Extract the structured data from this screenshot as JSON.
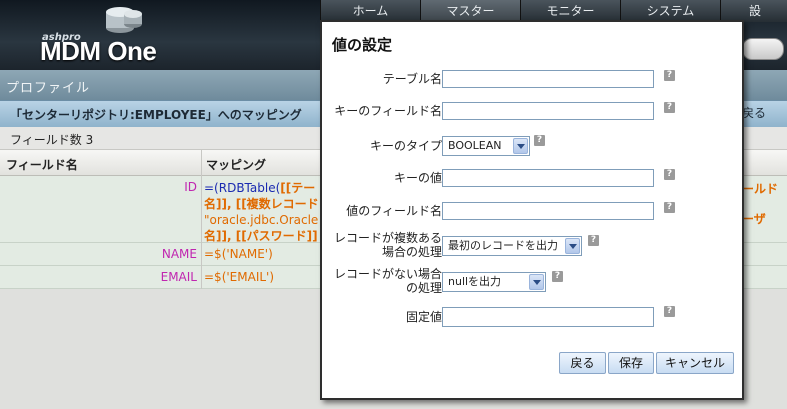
{
  "app": {
    "logo_brand": "ashpro",
    "logo_title": "MDM One"
  },
  "nav": {
    "items": [
      "ホーム",
      "マスター",
      "モニター",
      "システム",
      "設"
    ]
  },
  "page": {
    "profile_title": "プロファイル",
    "mapping_title": "「センターリポジトリ:EMPLOYEE」へのマッピング",
    "back_label": "戻る",
    "field_count": "フィールド数 3",
    "columns": [
      "フィールド名",
      "マッピング"
    ],
    "rows": [
      {
        "field": "ID",
        "mapping_lines": [
          [
            {
              "t": "=(RDBTable(",
              "c": "kw"
            },
            {
              "t": "[[テー",
              "c": "prm"
            }
          ],
          [
            {
              "t": "名]], [[複数レコード",
              "c": "prm"
            }
          ],
          [
            {
              "t": "\"oracle.jdbc.Oracle",
              "c": "str"
            }
          ],
          [
            {
              "t": "名]], [[パスワード]]",
              "c": "prm"
            }
          ]
        ],
        "cut_right": [
          "ールド",
          "ーザ"
        ]
      },
      {
        "field": "NAME",
        "mapping": "=$('NAME')"
      },
      {
        "field": "EMAIL",
        "mapping": "=$('EMAIL')"
      }
    ]
  },
  "dialog": {
    "title": "値の設定",
    "fields": {
      "table_name": {
        "label": "テーブル名",
        "value": ""
      },
      "key_field": {
        "label": "キーのフィールド名",
        "value": ""
      },
      "key_type": {
        "label": "キーのタイプ",
        "selected": "BOOLEAN"
      },
      "key_value": {
        "label": "キーの値",
        "value": ""
      },
      "value_field": {
        "label": "値のフィールド名",
        "value": ""
      },
      "multi_record": {
        "label_line1": "レコードが複数ある",
        "label_line2": "場合の処理",
        "selected": "最初のレコードを出力"
      },
      "no_record": {
        "label_line1": "レコードがない場合",
        "label_line2": "の処理",
        "selected": "nullを出力"
      },
      "fixed_value": {
        "label": "固定値",
        "value": ""
      }
    },
    "help_glyph": "?",
    "buttons": {
      "back": "戻る",
      "save": "保存",
      "cancel": "キャンセル"
    }
  }
}
